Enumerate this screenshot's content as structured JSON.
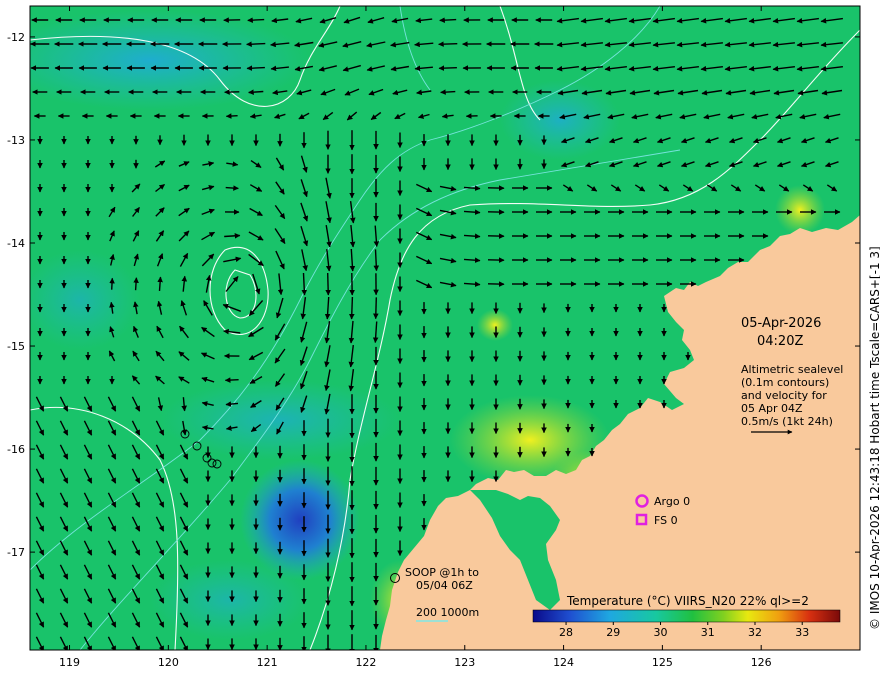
{
  "map": {
    "lon_ticks": [
      119,
      120,
      121,
      122,
      123,
      124,
      125,
      126
    ],
    "lat_ticks": [
      -12,
      -13,
      -14,
      -15,
      -16,
      -17
    ],
    "lon_range": [
      118.6,
      127.0
    ],
    "lat_range": [
      -17.95,
      -11.7
    ]
  },
  "annotation": {
    "date": "05-Apr-2026",
    "time": "04:20Z",
    "desc_lines": [
      "Altimetric sealevel",
      "(0.1m contours)",
      "and velocity for",
      "05 Apr 04Z",
      "0.5m/s (1kt 24h)"
    ]
  },
  "legend": {
    "argo": "Argo 0",
    "fs": "FS 0",
    "soop_line1": "SOOP @1h to",
    "soop_line2": "05/04 06Z",
    "bathy": "200  1000m"
  },
  "colorbar": {
    "title": "Temperature (°C) VIIRS_N20 22% ql>=2",
    "min": 27.3,
    "max": 33.8,
    "ticks": [
      28,
      29,
      30,
      31,
      32,
      33
    ]
  },
  "credit": "© IMOS 10-Apr-2026 12:43:18 Hobart time Tscale=CARS+[-1 3]",
  "colors": {
    "land": "#f9c99c",
    "sst_main": "#19c36a",
    "sst_cool": "#22a8c8",
    "sst_warm": "#c8e030",
    "argo": "#e020e0",
    "contour": "#ffffff",
    "isobath": "#7fe7e7"
  }
}
